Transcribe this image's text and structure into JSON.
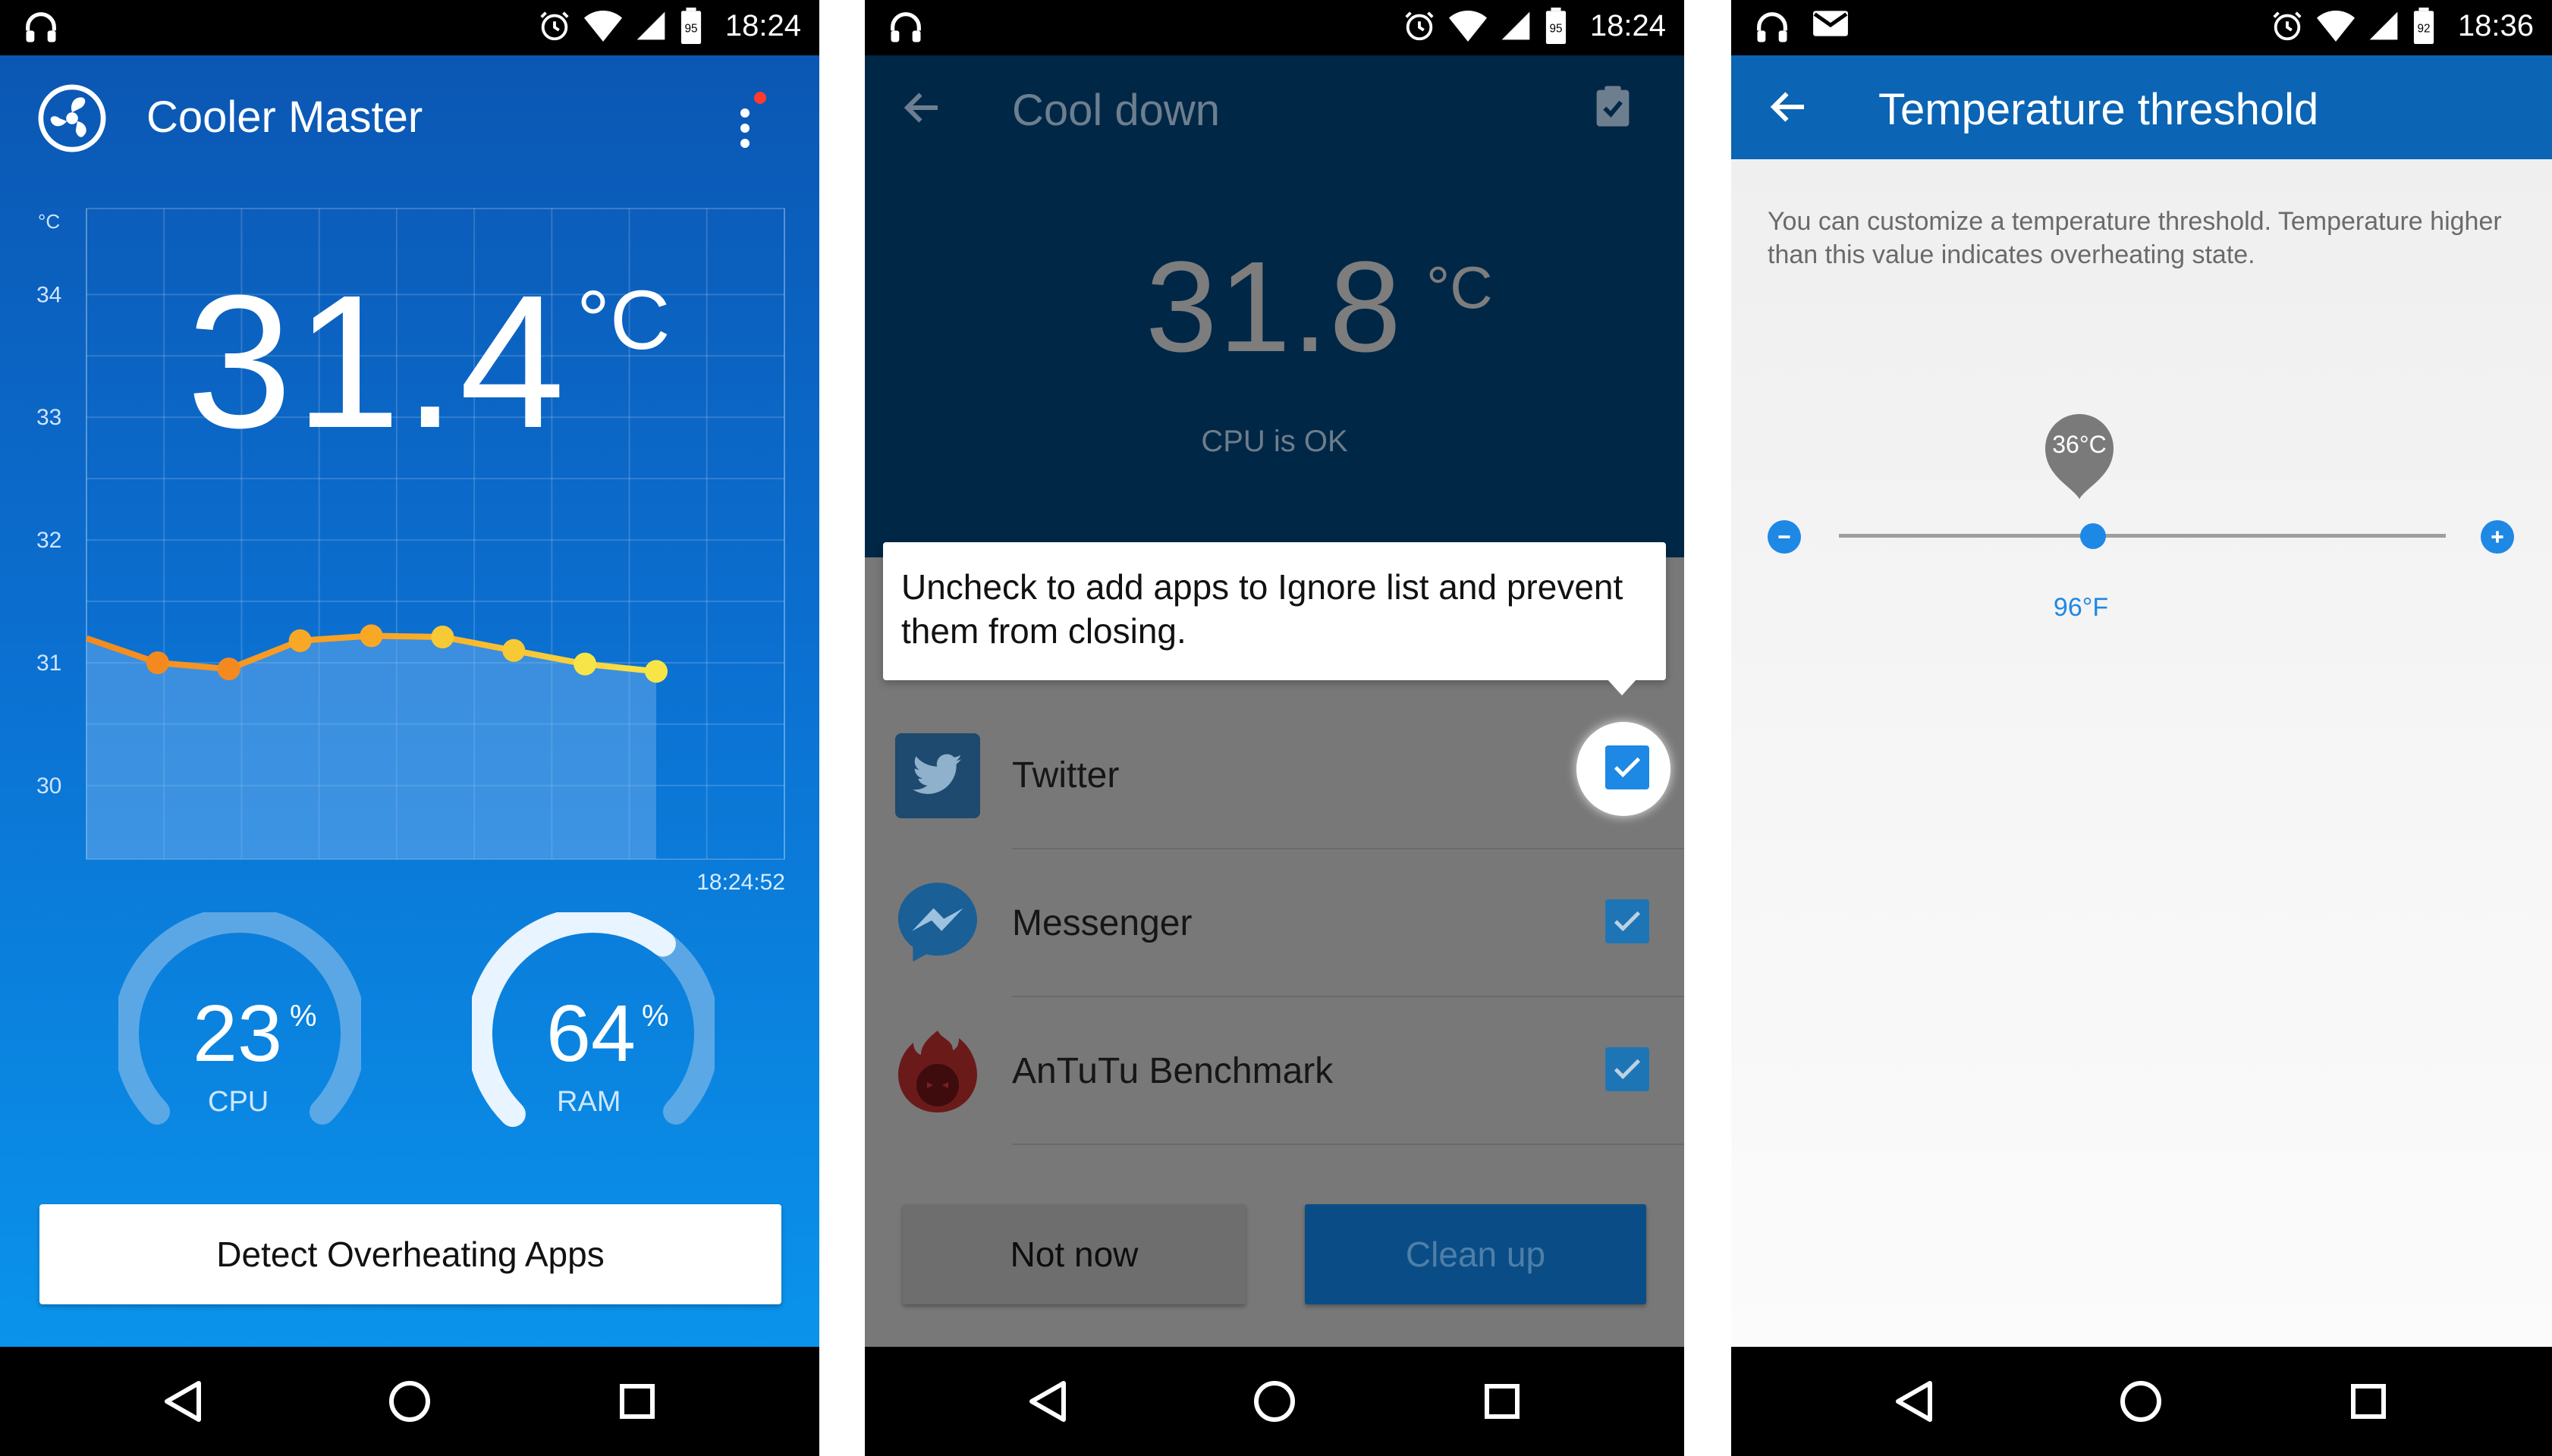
{
  "screen1": {
    "status_time": "18:24",
    "app_title": "Cooler Master",
    "temperature": "31.4",
    "temp_unit": "°C",
    "chart_data": {
      "type": "line",
      "ylabel": "°C",
      "y_ticks": [
        "34",
        "33",
        "32",
        "31",
        "30"
      ],
      "ylim": [
        29.4,
        34.7
      ],
      "values": [
        31.2,
        31.0,
        30.95,
        31.18,
        31.22,
        31.21,
        31.1,
        30.99,
        30.93
      ],
      "x_end_label": "18:24:52",
      "colors": [
        "#f48a1f",
        "#f9a826",
        "#f6c935",
        "#f7e547"
      ],
      "grid": true
    },
    "cpu": {
      "value": "23",
      "unit": "%",
      "label": "CPU",
      "fraction": 0.23
    },
    "ram": {
      "value": "64",
      "unit": "%",
      "label": "RAM",
      "fraction": 0.64
    },
    "detect_button": "Detect Overheating Apps"
  },
  "screen2": {
    "status_time": "18:24",
    "title": "Cool down",
    "temperature": "31.8",
    "temp_unit": "°C",
    "status": "CPU is OK",
    "tooltip": "Uncheck to add apps to Ignore list and prevent them from closing.",
    "apps": [
      {
        "name": "Twitter",
        "checked": true
      },
      {
        "name": "Messenger",
        "checked": true
      },
      {
        "name": "AnTuTu Benchmark",
        "checked": true
      }
    ],
    "not_now_button": "Not now",
    "clean_up_button": "Clean up"
  },
  "screen3": {
    "status_time": "18:36",
    "title": "Temperature threshold",
    "description": "You can customize a temperature threshold. Temperature higher than this value indicates overheating state.",
    "slider_celsius": "36°C",
    "slider_fahrenheit": "96°F"
  },
  "battery_levels": [
    "95",
    "95",
    "92"
  ]
}
